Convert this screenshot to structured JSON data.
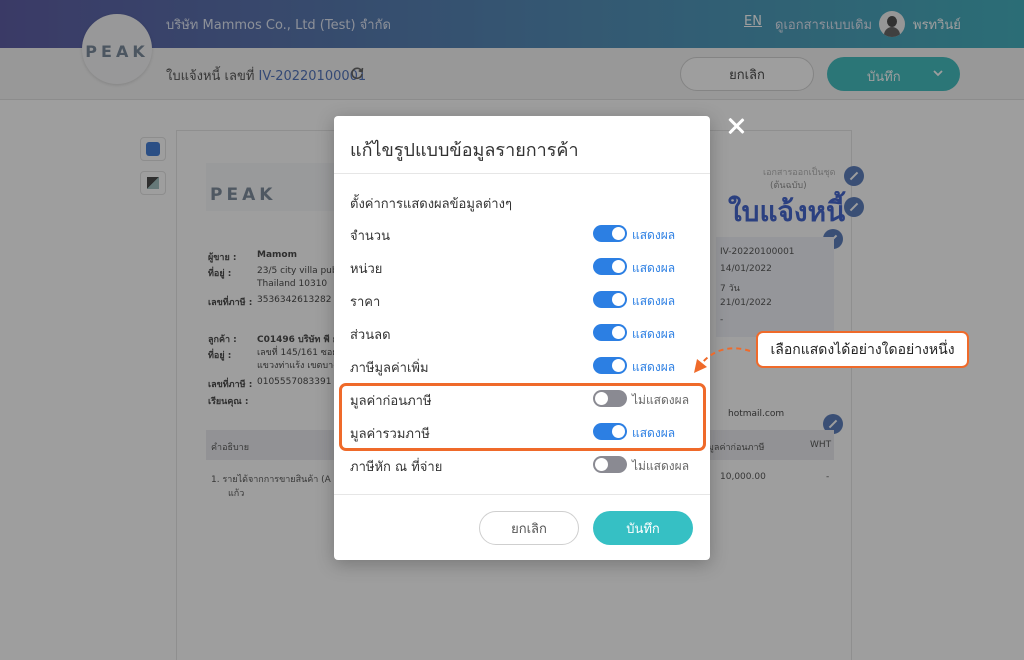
{
  "topbar": {
    "logo": "PEAK",
    "company": "บริษัท Mammos Co., Ltd (Test) จำกัด",
    "lang": "EN",
    "old_docs": "ดูเอกสารแบบเดิม",
    "username": "พรทวินย์"
  },
  "subbar": {
    "doc_label": "ใบแจ้งหนี้ เลขที่",
    "doc_number": "IV-20220100001",
    "cancel": "ยกเลิก",
    "save": "บันทึก"
  },
  "document": {
    "logo": "PEAK",
    "title": "ใบแจ้งหนี้",
    "original": "(ต้นฉบับ)",
    "original_caption": "เอกสารออกเป็นชุด",
    "seller_label": "ผู้ขาย :",
    "seller_name": "Mamom",
    "address_label": "ที่อยู่ :",
    "address_1": "23/5 city villa pub",
    "address_2": "Thailand 10310",
    "taxid_label": "เลขที่ภาษี :",
    "taxid": "3536342613282",
    "customer_label": "ลูกค้า :",
    "customer": "C01496 บริษัท พี ยู",
    "cust_address_label": "ที่อยู่ :",
    "cust_address_1": "เลขที่ 145/161 ซอย",
    "cust_address_2": "แขวงท่าแร้ง เขตบาง",
    "cust_taxid_label": "เลขที่ภาษี :",
    "cust_taxid": "0105557083391",
    "attn_label": "เรียนคุณ :",
    "email": "hotmail.com",
    "meta": [
      "IV-20220100001",
      "14/01/2022",
      "7 วัน",
      "21/01/2022",
      "-"
    ],
    "col_desc": "คำอธิบาย",
    "col_pre": "มูลค่าก่อนภาษี",
    "col_wht": "WHT",
    "line_1": "1.  รายได้จากการขายสินค้า (A",
    "line_1b": "แก้ว",
    "line_amount": "10,000.00",
    "line_wht": "-"
  },
  "modal": {
    "title": "แก้ไขรูปแบบข้อมูลรายการค้า",
    "section": "ตั้งค่าการแสดงผลข้อมูลต่างๆ",
    "rows": [
      {
        "label": "จำนวน",
        "status": "แสดงผล",
        "on": true
      },
      {
        "label": "หน่วย",
        "status": "แสดงผล",
        "on": true
      },
      {
        "label": "ราคา",
        "status": "แสดงผล",
        "on": true
      },
      {
        "label": "ส่วนลด",
        "status": "แสดงผล",
        "on": true
      },
      {
        "label": "ภาษีมูลค่าเพิ่ม",
        "status": "แสดงผล",
        "on": true
      },
      {
        "label": "มูลค่าก่อนภาษี",
        "status": "ไม่แสดงผล",
        "on": false
      },
      {
        "label": "มูลค่ารวมภาษี",
        "status": "แสดงผล",
        "on": true
      },
      {
        "label": "ภาษีหัก ณ ที่จ่าย",
        "status": "ไม่แสดงผล",
        "on": false
      }
    ],
    "cancel": "ยกเลิก",
    "save": "บันทึก"
  },
  "annotation": {
    "callout": "เลือกแสดงได้อย่างใดอย่างหนึ่ง"
  },
  "colors": {
    "accent": "#2c7fe3",
    "teal": "#36c0c4",
    "highlight": "#ef6a2a"
  }
}
